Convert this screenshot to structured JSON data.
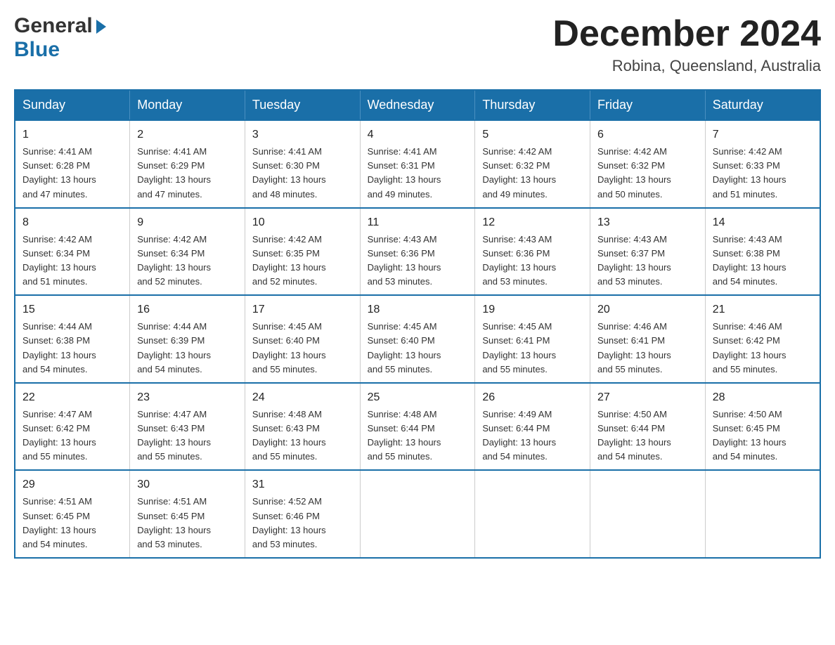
{
  "logo": {
    "general": "General",
    "blue": "Blue",
    "triangle": "▶"
  },
  "title": {
    "month": "December 2024",
    "location": "Robina, Queensland, Australia"
  },
  "headers": [
    "Sunday",
    "Monday",
    "Tuesday",
    "Wednesday",
    "Thursday",
    "Friday",
    "Saturday"
  ],
  "weeks": [
    [
      {
        "day": "1",
        "info": "Sunrise: 4:41 AM\nSunset: 6:28 PM\nDaylight: 13 hours\nand 47 minutes."
      },
      {
        "day": "2",
        "info": "Sunrise: 4:41 AM\nSunset: 6:29 PM\nDaylight: 13 hours\nand 47 minutes."
      },
      {
        "day": "3",
        "info": "Sunrise: 4:41 AM\nSunset: 6:30 PM\nDaylight: 13 hours\nand 48 minutes."
      },
      {
        "day": "4",
        "info": "Sunrise: 4:41 AM\nSunset: 6:31 PM\nDaylight: 13 hours\nand 49 minutes."
      },
      {
        "day": "5",
        "info": "Sunrise: 4:42 AM\nSunset: 6:32 PM\nDaylight: 13 hours\nand 49 minutes."
      },
      {
        "day": "6",
        "info": "Sunrise: 4:42 AM\nSunset: 6:32 PM\nDaylight: 13 hours\nand 50 minutes."
      },
      {
        "day": "7",
        "info": "Sunrise: 4:42 AM\nSunset: 6:33 PM\nDaylight: 13 hours\nand 51 minutes."
      }
    ],
    [
      {
        "day": "8",
        "info": "Sunrise: 4:42 AM\nSunset: 6:34 PM\nDaylight: 13 hours\nand 51 minutes."
      },
      {
        "day": "9",
        "info": "Sunrise: 4:42 AM\nSunset: 6:34 PM\nDaylight: 13 hours\nand 52 minutes."
      },
      {
        "day": "10",
        "info": "Sunrise: 4:42 AM\nSunset: 6:35 PM\nDaylight: 13 hours\nand 52 minutes."
      },
      {
        "day": "11",
        "info": "Sunrise: 4:43 AM\nSunset: 6:36 PM\nDaylight: 13 hours\nand 53 minutes."
      },
      {
        "day": "12",
        "info": "Sunrise: 4:43 AM\nSunset: 6:36 PM\nDaylight: 13 hours\nand 53 minutes."
      },
      {
        "day": "13",
        "info": "Sunrise: 4:43 AM\nSunset: 6:37 PM\nDaylight: 13 hours\nand 53 minutes."
      },
      {
        "day": "14",
        "info": "Sunrise: 4:43 AM\nSunset: 6:38 PM\nDaylight: 13 hours\nand 54 minutes."
      }
    ],
    [
      {
        "day": "15",
        "info": "Sunrise: 4:44 AM\nSunset: 6:38 PM\nDaylight: 13 hours\nand 54 minutes."
      },
      {
        "day": "16",
        "info": "Sunrise: 4:44 AM\nSunset: 6:39 PM\nDaylight: 13 hours\nand 54 minutes."
      },
      {
        "day": "17",
        "info": "Sunrise: 4:45 AM\nSunset: 6:40 PM\nDaylight: 13 hours\nand 55 minutes."
      },
      {
        "day": "18",
        "info": "Sunrise: 4:45 AM\nSunset: 6:40 PM\nDaylight: 13 hours\nand 55 minutes."
      },
      {
        "day": "19",
        "info": "Sunrise: 4:45 AM\nSunset: 6:41 PM\nDaylight: 13 hours\nand 55 minutes."
      },
      {
        "day": "20",
        "info": "Sunrise: 4:46 AM\nSunset: 6:41 PM\nDaylight: 13 hours\nand 55 minutes."
      },
      {
        "day": "21",
        "info": "Sunrise: 4:46 AM\nSunset: 6:42 PM\nDaylight: 13 hours\nand 55 minutes."
      }
    ],
    [
      {
        "day": "22",
        "info": "Sunrise: 4:47 AM\nSunset: 6:42 PM\nDaylight: 13 hours\nand 55 minutes."
      },
      {
        "day": "23",
        "info": "Sunrise: 4:47 AM\nSunset: 6:43 PM\nDaylight: 13 hours\nand 55 minutes."
      },
      {
        "day": "24",
        "info": "Sunrise: 4:48 AM\nSunset: 6:43 PM\nDaylight: 13 hours\nand 55 minutes."
      },
      {
        "day": "25",
        "info": "Sunrise: 4:48 AM\nSunset: 6:44 PM\nDaylight: 13 hours\nand 55 minutes."
      },
      {
        "day": "26",
        "info": "Sunrise: 4:49 AM\nSunset: 6:44 PM\nDaylight: 13 hours\nand 54 minutes."
      },
      {
        "day": "27",
        "info": "Sunrise: 4:50 AM\nSunset: 6:44 PM\nDaylight: 13 hours\nand 54 minutes."
      },
      {
        "day": "28",
        "info": "Sunrise: 4:50 AM\nSunset: 6:45 PM\nDaylight: 13 hours\nand 54 minutes."
      }
    ],
    [
      {
        "day": "29",
        "info": "Sunrise: 4:51 AM\nSunset: 6:45 PM\nDaylight: 13 hours\nand 54 minutes."
      },
      {
        "day": "30",
        "info": "Sunrise: 4:51 AM\nSunset: 6:45 PM\nDaylight: 13 hours\nand 53 minutes."
      },
      {
        "day": "31",
        "info": "Sunrise: 4:52 AM\nSunset: 6:46 PM\nDaylight: 13 hours\nand 53 minutes."
      },
      {
        "day": "",
        "info": ""
      },
      {
        "day": "",
        "info": ""
      },
      {
        "day": "",
        "info": ""
      },
      {
        "day": "",
        "info": ""
      }
    ]
  ]
}
